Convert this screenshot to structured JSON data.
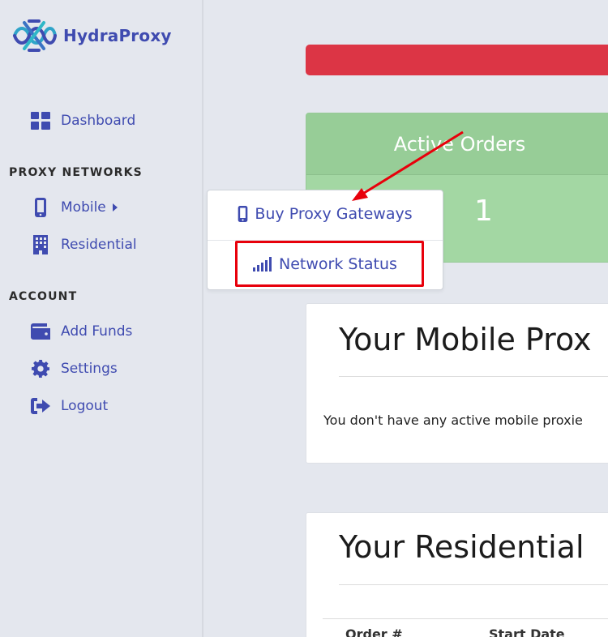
{
  "brand": {
    "name": "HydraProxy",
    "logo_icon": "knot-logo-icon"
  },
  "sidebar": {
    "dashboard_label": "Dashboard",
    "section_proxy": "PROXY NETWORKS",
    "mobile_label": "Mobile",
    "residential_label": "Residential",
    "section_account": "ACCOUNT",
    "add_funds_label": "Add Funds",
    "settings_label": "Settings",
    "logout_label": "Logout"
  },
  "dropdown": {
    "buy_label": "Buy Proxy Gateways",
    "status_label": "Network Status"
  },
  "orders": {
    "title": "Active Orders",
    "count": "1"
  },
  "mobile_panel": {
    "title": "Your Mobile Prox",
    "empty_text": "You don't have any active mobile proxie"
  },
  "residential_panel": {
    "title": "Your Residential",
    "col_order": "Order #",
    "col_start": "Start Date"
  },
  "colors": {
    "accent": "#3f4bb0",
    "alert": "#dc3545",
    "success": "#a3d7a3",
    "annotation": "#e8000b"
  }
}
